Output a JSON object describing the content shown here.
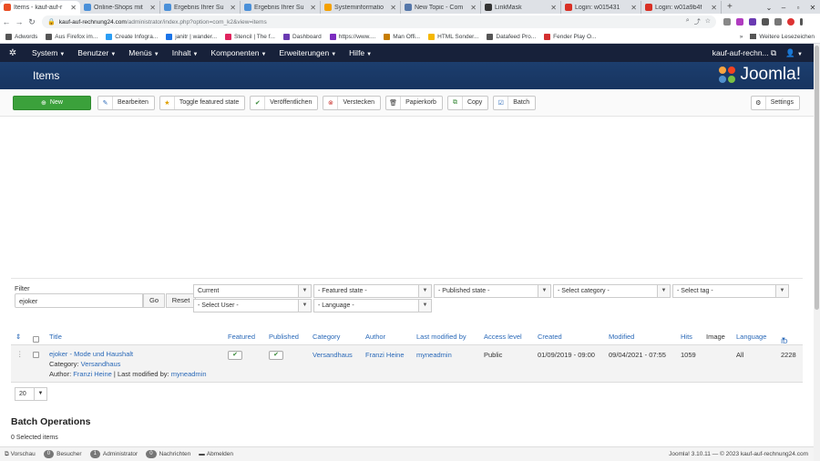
{
  "browser": {
    "tabs": [
      {
        "title": "Items - kauf-auf-r",
        "color": "#e94e24",
        "active": true
      },
      {
        "title": "Online-Shops mit",
        "color": "#4a90d9"
      },
      {
        "title": "Ergebnis Ihrer Su",
        "color": "#4a90d9"
      },
      {
        "title": "Ergebnis Ihrer Su",
        "color": "#4a90d9"
      },
      {
        "title": "Systeminformatio",
        "color": "#f4a100"
      },
      {
        "title": "New Topic - Com",
        "color": "#5577aa"
      },
      {
        "title": "LinkMask",
        "color": "#333333"
      },
      {
        "title": "Login: w015431",
        "color": "#d93025"
      },
      {
        "title": "Login: w01a9b4f",
        "color": "#d93025"
      }
    ],
    "url_host": "kauf-auf-rechnung24.com",
    "url_path": "/administrator/index.php?option=com_k2&view=items",
    "bookmarks": [
      {
        "label": "Adwords",
        "color": "#555555"
      },
      {
        "label": "Aus Firefox im...",
        "color": "#555555"
      },
      {
        "label": "Create Infogra...",
        "color": "#2a9df4"
      },
      {
        "label": "janitr | wander...",
        "color": "#1a73e8"
      },
      {
        "label": "Stencil | The f...",
        "color": "#e0245e"
      },
      {
        "label": "Dashboard",
        "color": "#6a3ab2"
      },
      {
        "label": "https://www....",
        "color": "#7b2cbf"
      },
      {
        "label": "Man Offi...",
        "color": "#c77d00"
      },
      {
        "label": "HTML Sonder...",
        "color": "#f5b700"
      },
      {
        "label": "Datafeed Pro...",
        "color": "#555555"
      },
      {
        "label": "Fender Play O...",
        "color": "#d32f2f"
      }
    ],
    "bookmarks_more": "Weitere Lesezeichen"
  },
  "nav": {
    "menus": [
      "System",
      "Benutzer",
      "Menüs",
      "Inhalt",
      "Komponenten",
      "Erweiterungen",
      "Hilfe"
    ],
    "site_link": "kauf-auf-rechn..."
  },
  "header": {
    "title": "Items",
    "brand": "Joomla!"
  },
  "toolbar": {
    "new": "New",
    "edit": "Bearbeiten",
    "featured": "Toggle featured state",
    "publish": "Veröffentlichen",
    "hide": "Verstecken",
    "trash": "Papierkorb",
    "copy": "Copy",
    "batch": "Batch",
    "settings": "Settings"
  },
  "filters": {
    "label": "Filter",
    "search_value": "ejoker",
    "go": "Go",
    "reset": "Reset",
    "current": "Current",
    "featured_state": "- Featured state -",
    "published_state": "- Published state -",
    "category": "- Select category -",
    "tag": "- Select tag -",
    "user": "- Select User -",
    "language": "- Language -"
  },
  "table": {
    "headers": {
      "title": "Title",
      "featured": "Featured",
      "published": "Published",
      "category": "Category",
      "author": "Author",
      "last_modified_by": "Last modified by",
      "access_level": "Access level",
      "created": "Created",
      "modified": "Modified",
      "hits": "Hits",
      "image": "Image",
      "language": "Language",
      "id": "ID"
    },
    "row": {
      "title": "ejoker - Mode und Haushalt",
      "category_label": "Category:",
      "category": "Versandhaus",
      "author_label": "Author:",
      "author": "Franzi Heine",
      "modified_label": "| Last modified by:",
      "modifier": "myneadmin",
      "access": "Public",
      "created": "01/09/2019 - 09:00",
      "modified": "09/04/2021 - 07:55",
      "hits": "1059",
      "language": "All",
      "id": "2228"
    }
  },
  "pagination": {
    "limit": "20"
  },
  "batch": {
    "title": "Batch Operations",
    "selected": "0 Selected items"
  },
  "statusbar": {
    "preview": "Vorschau",
    "visitors_count": "0",
    "visitors": "Besucher",
    "admins_count": "1",
    "admins": "Administrator",
    "messages_count": "0",
    "messages": "Nachrichten",
    "logout": "Abmelden",
    "version": "Joomla! 3.10.11",
    "copyright": "— © 2023 kauf-auf-rechnung24.com"
  }
}
